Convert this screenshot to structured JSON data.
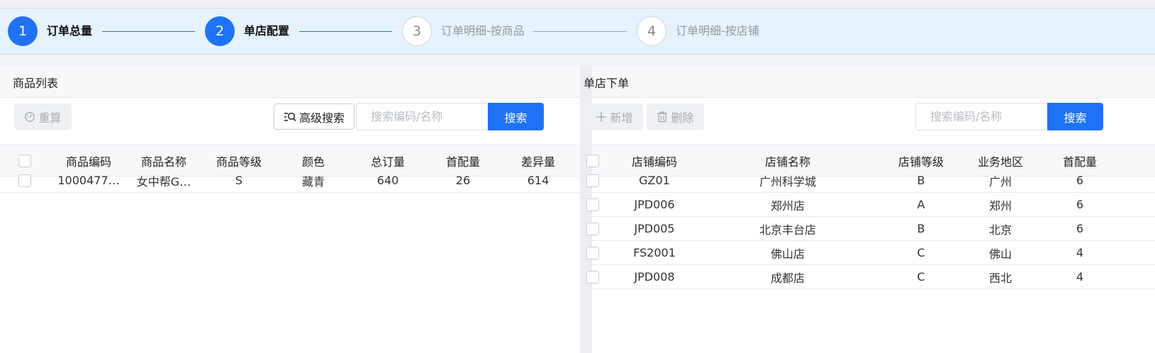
{
  "stepper": {
    "steps": [
      {
        "num": "1",
        "label": "订单总量"
      },
      {
        "num": "2",
        "label": "单店配置"
      },
      {
        "num": "3",
        "label": "订单明细-按商品"
      },
      {
        "num": "4",
        "label": "订单明细-按店铺"
      }
    ],
    "colors": {
      "active": "#1f72f5",
      "idle": "#9aa6b2"
    }
  },
  "left": {
    "title": "商品列表",
    "recalc_label": "重算",
    "advanced_search_label": "高级搜索",
    "search_placeholder": "搜索编码/名称",
    "search_label": "搜索",
    "columns": [
      "商品编码",
      "商品名称",
      "商品等级",
      "颜色",
      "总订量",
      "首配量",
      "差异量"
    ],
    "rows": [
      [
        "1000477…",
        "女中帮G…",
        "S",
        "藏青",
        "640",
        "26",
        "614"
      ]
    ]
  },
  "right": {
    "title": "单店下单",
    "add_label": "新增",
    "delete_label": "删除",
    "search_placeholder": "搜索编码/名称",
    "search_label": "搜索",
    "columns": [
      "店铺编码",
      "店铺名称",
      "店铺等级",
      "业务地区",
      "首配量"
    ],
    "rows": [
      [
        "GZ01",
        "广州科学城",
        "B",
        "广州",
        "6"
      ],
      [
        "JPD006",
        "郑州店",
        "A",
        "郑州",
        "6"
      ],
      [
        "JPD005",
        "北京丰台店",
        "B",
        "北京",
        "6"
      ],
      [
        "FS2001",
        "佛山店",
        "C",
        "佛山",
        "4"
      ],
      [
        "JPD008",
        "成都店",
        "C",
        "西北",
        "4"
      ]
    ]
  },
  "theme": {
    "primary": "#1f72f5",
    "step_bg": "#e6f2fd"
  }
}
